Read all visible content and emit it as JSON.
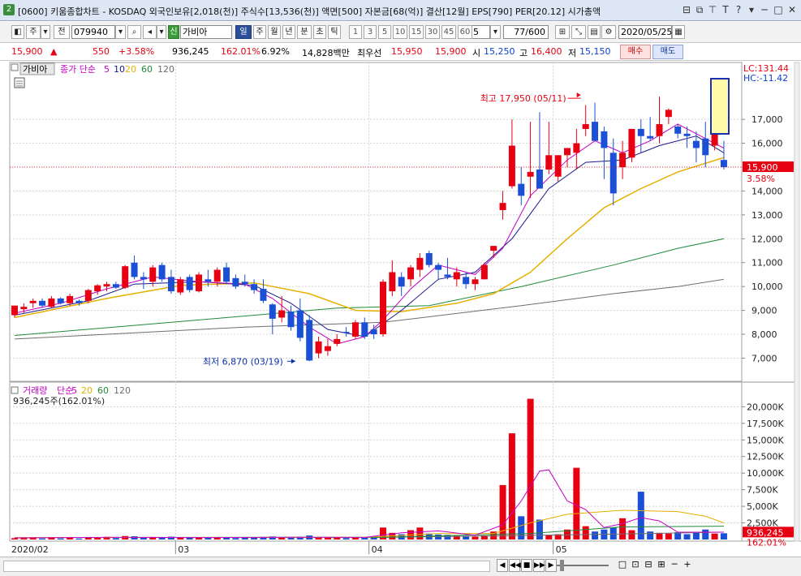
{
  "window": {
    "code": "[0600]",
    "app_name": "키움종합차트",
    "title_info": "- KOSDAQ 외국인보유[2,018(천)] 주식수[13,536(천)] 액면[500] 자본금[68(억)] 결산[12월] EPS[790] PER[20.12] 시가총액",
    "num_badge": "2"
  },
  "toolbar": {
    "type_label": "주",
    "prev_label": "전",
    "code_value": "079940",
    "new_badge": "신",
    "stock_name": "가비아",
    "periods": [
      "일",
      "주",
      "월",
      "년",
      "분",
      "초",
      "틱"
    ],
    "minutes": [
      "1",
      "3",
      "5",
      "10",
      "15",
      "30",
      "45",
      "60"
    ],
    "interval_value": "5",
    "count_value": "77/600",
    "date_value": "2020/05/25"
  },
  "quote": {
    "price": "15,900",
    "arrow": "▲",
    "change": "550",
    "change_pct": "+3.58%",
    "volume": "936,245",
    "vol_ratio": "162.01%",
    "turnover": "6.92%",
    "amount": "14,828백만",
    "best_label": "최우선",
    "ask": "15,950",
    "bid": "15,900",
    "open_label": "시",
    "open": "15,250",
    "high_label": "고",
    "high": "16,400",
    "low_label": "저",
    "low": "15,150",
    "buy_label": "매수",
    "sell_label": "매도"
  },
  "colors": {
    "up": "#e60012",
    "down": "#1b4fd6",
    "ma5": "#c400c4",
    "ma10": "#1a1a8c",
    "ma20": "#e6b000",
    "ma60": "#1e8a3a",
    "ma120": "#6e6e6e",
    "grid": "#d4d4d4"
  },
  "chart_data": [
    {
      "type": "candlestick",
      "panel": "price",
      "legend": {
        "name": "가비아",
        "ma_label": "종가 단순",
        "periods": [
          "5",
          "10",
          "20",
          "60",
          "120"
        ]
      },
      "y_axis": {
        "ticks": [
          7000,
          8000,
          9000,
          10000,
          11000,
          12000,
          13000,
          14000,
          15000,
          16000,
          17000
        ],
        "tick_labels": [
          "7,000",
          "8,000",
          "9,000",
          "10,000",
          "11,000",
          "12,000",
          "13,000",
          "14,000",
          "15,000",
          "16,000",
          "17,000"
        ],
        "range": [
          6200,
          18500
        ]
      },
      "x_labels": [
        "2020/02",
        "03",
        "04",
        "05"
      ],
      "x_label_index": [
        0,
        18,
        39,
        59
      ],
      "current_price_label": "15,900",
      "current_pct_label": "3.58%",
      "lc_label": "LC:131.44",
      "hc_label": "HC:-11.42",
      "annotations": [
        {
          "text": "최고 17,950 (05/11)",
          "index": 62,
          "value": 17950
        },
        {
          "text": "최저 6,870 (03/19)",
          "index": 31,
          "value": 6870
        }
      ],
      "ohlc": [
        [
          8800,
          9200,
          8700,
          9200
        ],
        [
          9050,
          9300,
          8900,
          9150
        ],
        [
          9300,
          9500,
          9100,
          9400
        ],
        [
          9400,
          9500,
          9100,
          9200
        ],
        [
          9150,
          9600,
          9100,
          9500
        ],
        [
          9500,
          9550,
          9250,
          9300
        ],
        [
          9300,
          9700,
          9200,
          9600
        ],
        [
          9400,
          9450,
          9200,
          9300
        ],
        [
          9400,
          9900,
          9300,
          9850
        ],
        [
          9800,
          10100,
          9650,
          10050
        ],
        [
          10000,
          10200,
          9800,
          10100
        ],
        [
          10100,
          10200,
          9900,
          9950
        ],
        [
          9950,
          10900,
          9900,
          10850
        ],
        [
          11000,
          11300,
          10300,
          10400
        ],
        [
          10400,
          10600,
          9900,
          10300
        ],
        [
          10200,
          10900,
          10000,
          10800
        ],
        [
          10900,
          11000,
          10200,
          10300
        ],
        [
          10400,
          10700,
          9700,
          9800
        ],
        [
          9750,
          10400,
          9650,
          10300
        ],
        [
          10400,
          10500,
          9750,
          9850
        ],
        [
          9800,
          10600,
          9750,
          10500
        ],
        [
          10300,
          10700,
          10000,
          10200
        ],
        [
          10200,
          10800,
          10000,
          10700
        ],
        [
          10800,
          11000,
          10100,
          10200
        ],
        [
          10350,
          10500,
          9900,
          10000
        ],
        [
          10200,
          10500,
          10000,
          10100
        ],
        [
          10100,
          10300,
          9700,
          9850
        ],
        [
          9900,
          10300,
          9300,
          9400
        ],
        [
          9250,
          9300,
          8000,
          8650
        ],
        [
          8700,
          9600,
          8500,
          9000
        ],
        [
          8950,
          9200,
          8150,
          8300
        ],
        [
          9000,
          9500,
          7700,
          7850
        ],
        [
          8600,
          8800,
          6870,
          6900
        ],
        [
          7200,
          7900,
          7000,
          7700
        ],
        [
          7300,
          7800,
          7100,
          7500
        ],
        [
          7600,
          8000,
          7500,
          7800
        ],
        [
          8100,
          8300,
          7900,
          8050
        ],
        [
          7900,
          8600,
          7800,
          8500
        ],
        [
          8500,
          8700,
          7800,
          7900
        ],
        [
          8200,
          8400,
          7800,
          8000
        ],
        [
          8000,
          10300,
          7900,
          10200
        ],
        [
          9800,
          11100,
          9600,
          10600
        ],
        [
          10400,
          10600,
          9600,
          10000
        ],
        [
          10300,
          10900,
          10000,
          10800
        ],
        [
          10700,
          11400,
          10400,
          11200
        ],
        [
          11400,
          11500,
          10800,
          10900
        ],
        [
          10900,
          11000,
          10300,
          10700
        ],
        [
          10500,
          11200,
          10300,
          10400
        ],
        [
          10300,
          10800,
          10000,
          10600
        ],
        [
          10400,
          10600,
          9900,
          10100
        ],
        [
          10100,
          10400,
          9850,
          10300
        ],
        [
          10300,
          11000,
          10300,
          10900
        ],
        [
          11500,
          11700,
          11200,
          11700
        ],
        [
          13200,
          14000,
          12800,
          13500
        ],
        [
          14200,
          17000,
          14100,
          15900
        ],
        [
          14300,
          15000,
          13400,
          13800
        ],
        [
          14600,
          16900,
          13700,
          14800
        ],
        [
          14900,
          17300,
          14300,
          14100
        ],
        [
          14900,
          16900,
          14700,
          15500
        ],
        [
          14600,
          15500,
          14400,
          15500
        ],
        [
          15500,
          15700,
          15000,
          15800
        ],
        [
          15600,
          16600,
          14900,
          16000
        ],
        [
          16600,
          17600,
          16300,
          16800
        ],
        [
          16900,
          17700,
          16500,
          16100
        ],
        [
          16500,
          16700,
          14500,
          15800
        ],
        [
          15600,
          16200,
          13400,
          13900
        ],
        [
          15000,
          16100,
          14500,
          15600
        ],
        [
          15400,
          16600,
          15200,
          16600
        ],
        [
          16600,
          17000,
          15600,
          16300
        ],
        [
          16300,
          17100,
          16100,
          16200
        ],
        [
          16300,
          17950,
          16000,
          16800
        ],
        [
          17100,
          17450,
          16800,
          17400
        ],
        [
          16700,
          16800,
          16200,
          16400
        ],
        [
          16400,
          16700,
          15800,
          16300
        ],
        [
          16100,
          16500,
          15200,
          15800
        ],
        [
          16200,
          16900,
          15000,
          15500
        ],
        [
          15900,
          16800,
          15700,
          16400
        ],
        [
          15300,
          16100,
          14900,
          15000
        ]
      ],
      "ma": {
        "5": [
          [
            0,
            8880
          ],
          [
            5,
            9300
          ],
          [
            10,
            9900
          ],
          [
            15,
            10400
          ],
          [
            20,
            10200
          ],
          [
            25,
            10100
          ],
          [
            28,
            9500
          ],
          [
            32,
            8300
          ],
          [
            35,
            7600
          ],
          [
            38,
            7900
          ],
          [
            40,
            8600
          ],
          [
            43,
            9900
          ],
          [
            46,
            10900
          ],
          [
            50,
            10500
          ],
          [
            53,
            11600
          ],
          [
            56,
            13800
          ],
          [
            60,
            15300
          ],
          [
            63,
            16100
          ],
          [
            66,
            15600
          ],
          [
            69,
            16100
          ],
          [
            72,
            16800
          ],
          [
            74,
            16400
          ],
          [
            77,
            15800
          ]
        ],
        "10": [
          [
            0,
            8800
          ],
          [
            8,
            9400
          ],
          [
            13,
            10100
          ],
          [
            20,
            10200
          ],
          [
            26,
            10050
          ],
          [
            30,
            9300
          ],
          [
            34,
            8200
          ],
          [
            38,
            7900
          ],
          [
            42,
            9000
          ],
          [
            46,
            10300
          ],
          [
            50,
            10600
          ],
          [
            54,
            12000
          ],
          [
            58,
            14100
          ],
          [
            62,
            15200
          ],
          [
            66,
            15300
          ],
          [
            70,
            15900
          ],
          [
            74,
            16300
          ],
          [
            77,
            15600
          ]
        ],
        "20": [
          [
            0,
            8700
          ],
          [
            10,
            9500
          ],
          [
            18,
            10050
          ],
          [
            26,
            10150
          ],
          [
            32,
            9700
          ],
          [
            37,
            9000
          ],
          [
            42,
            8950
          ],
          [
            48,
            9300
          ],
          [
            52,
            9700
          ],
          [
            56,
            10600
          ],
          [
            60,
            12000
          ],
          [
            64,
            13300
          ],
          [
            68,
            14100
          ],
          [
            72,
            14800
          ],
          [
            77,
            15400
          ]
        ],
        "60": [
          [
            0,
            7950
          ],
          [
            20,
            8600
          ],
          [
            35,
            9100
          ],
          [
            45,
            9200
          ],
          [
            55,
            10000
          ],
          [
            65,
            10900
          ],
          [
            72,
            11600
          ],
          [
            77,
            12000
          ]
        ],
        "120": [
          [
            0,
            7800
          ],
          [
            25,
            8300
          ],
          [
            40,
            8500
          ],
          [
            55,
            9200
          ],
          [
            65,
            9700
          ],
          [
            72,
            10000
          ],
          [
            77,
            10300
          ]
        ]
      }
    },
    {
      "type": "bar",
      "panel": "volume",
      "legend": {
        "name": "거래량",
        "ma_label": "단순",
        "periods": [
          "5",
          "20",
          "60",
          "120"
        ],
        "value_label": "936,245주(162.01%)"
      },
      "y_axis": {
        "ticks": [
          2500000,
          5000000,
          7500000,
          10000000,
          12500000,
          15000000,
          17500000,
          20000000
        ],
        "tick_labels": [
          "2,500K",
          "5,000K",
          "7,500K",
          "10,000K",
          "12,500K",
          "15,000K",
          "17,500K",
          "20,000K"
        ],
        "range": [
          0,
          22000000
        ]
      },
      "current_label": "936,245",
      "current_pct_label": "162.01%",
      "values": [
        200000,
        180000,
        250000,
        160000,
        300000,
        170000,
        280000,
        150000,
        350000,
        300000,
        400000,
        220000,
        520000,
        480000,
        300000,
        380000,
        260000,
        420000,
        250000,
        260000,
        300000,
        240000,
        330000,
        270000,
        220000,
        260000,
        300000,
        380000,
        450000,
        300000,
        380000,
        420000,
        600000,
        300000,
        260000,
        300000,
        220000,
        360000,
        260000,
        300000,
        1800000,
        1000000,
        800000,
        1400000,
        1800000,
        900000,
        750000,
        700000,
        560000,
        520000,
        420000,
        600000,
        1200000,
        8200000,
        16000000,
        3500000,
        21200000,
        3000000,
        700000,
        800000,
        1500000,
        10800000,
        2000000,
        1200000,
        1500000,
        1800000,
        3200000,
        1400000,
        7200000,
        1200000,
        1000000,
        900000,
        1100000,
        800000,
        1000000,
        1500000,
        900000,
        936245
      ],
      "ma5": [
        [
          0,
          250000
        ],
        [
          10,
          330000
        ],
        [
          20,
          290000
        ],
        [
          30,
          340000
        ],
        [
          38,
          320000
        ],
        [
          42,
          1000000
        ],
        [
          46,
          1300000
        ],
        [
          50,
          650000
        ],
        [
          53,
          2200000
        ],
        [
          55,
          5800000
        ],
        [
          57,
          10300000
        ],
        [
          58,
          10500000
        ],
        [
          60,
          5800000
        ],
        [
          62,
          4500000
        ],
        [
          64,
          1800000
        ],
        [
          66,
          2400000
        ],
        [
          68,
          3300000
        ],
        [
          70,
          2800000
        ],
        [
          72,
          1100000
        ],
        [
          77,
          1100000
        ]
      ],
      "ma20": [
        [
          0,
          300000
        ],
        [
          20,
          310000
        ],
        [
          38,
          330000
        ],
        [
          46,
          900000
        ],
        [
          52,
          900000
        ],
        [
          56,
          2500000
        ],
        [
          60,
          3800000
        ],
        [
          66,
          4400000
        ],
        [
          72,
          4200000
        ],
        [
          75,
          3500000
        ],
        [
          77,
          2500000
        ]
      ],
      "ma60": [
        [
          0,
          310000
        ],
        [
          40,
          330000
        ],
        [
          56,
          900000
        ],
        [
          66,
          1900000
        ],
        [
          77,
          2000000
        ]
      ],
      "ma120": [
        [
          0,
          300000
        ],
        [
          40,
          320000
        ],
        [
          60,
          700000
        ],
        [
          77,
          1100000
        ]
      ]
    }
  ],
  "bottombar": {
    "nav": [
      "◀",
      "◀◀",
      "■",
      "▶▶",
      "▶"
    ],
    "tools": [
      "□",
      "⊡",
      "⊟",
      "⊞",
      "─",
      "+"
    ]
  }
}
